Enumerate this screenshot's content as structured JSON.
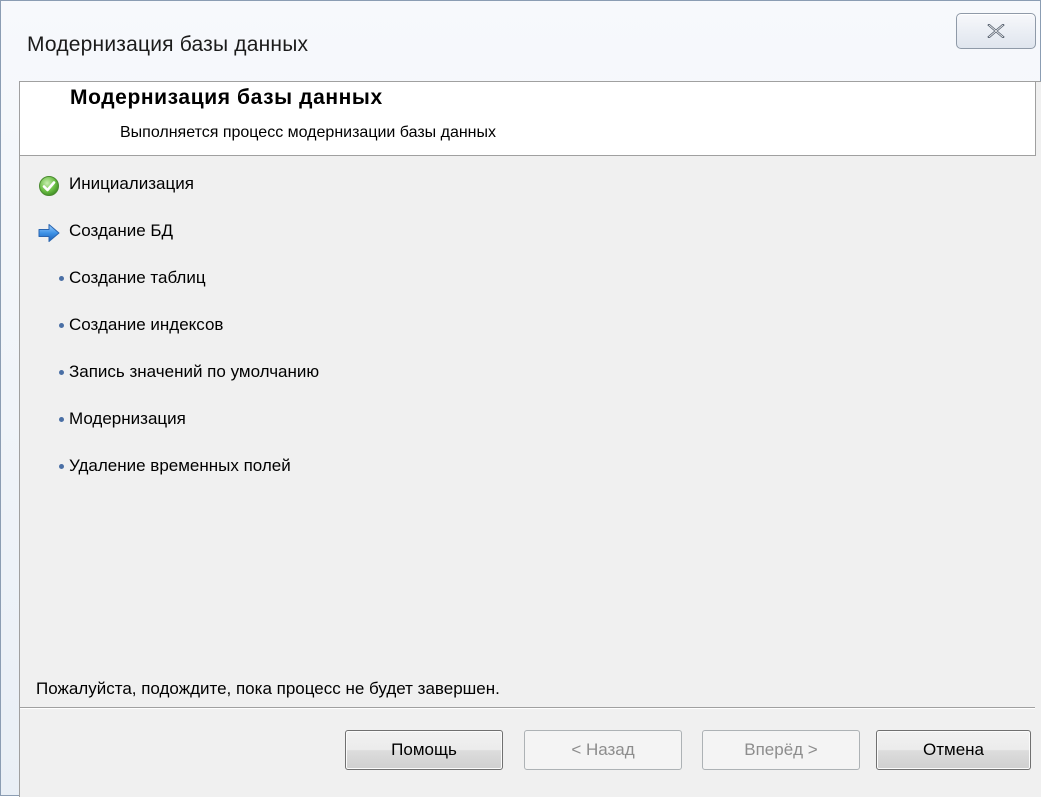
{
  "window": {
    "title": "Модернизация базы данных",
    "close_icon": "close-icon"
  },
  "header": {
    "title": "Модернизация базы данных",
    "subtitle": "Выполняется процесс модернизации базы данных"
  },
  "steps": [
    {
      "label": "Инициализация",
      "status": "done",
      "icon": "checkmark-icon"
    },
    {
      "label": "Создание БД",
      "status": "current",
      "icon": "arrow-right-icon"
    },
    {
      "label": "Создание таблиц",
      "status": "pending",
      "icon": "bullet-icon"
    },
    {
      "label": "Создание индексов",
      "status": "pending",
      "icon": "bullet-icon"
    },
    {
      "label": "Запись значений по умолчанию",
      "status": "pending",
      "icon": "bullet-icon"
    },
    {
      "label": "Модернизация",
      "status": "pending",
      "icon": "bullet-icon"
    },
    {
      "label": "Удаление временных полей",
      "status": "pending",
      "icon": "bullet-icon"
    }
  ],
  "status_text": "Пожалуйста, подождите, пока процесс не будет завершен.",
  "buttons": {
    "help": "Помощь",
    "back": "< Назад",
    "next": "Вперёд >",
    "cancel": "Отмена"
  },
  "colors": {
    "done": "#4aa02c",
    "current": "#3b8be0",
    "pending": "#4a6fa5"
  }
}
